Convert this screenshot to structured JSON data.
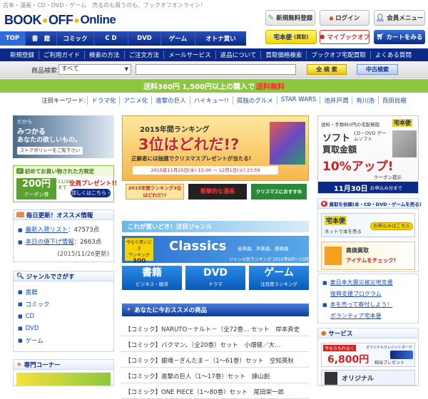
{
  "header": {
    "tagline": "古本・漫画・CD・DVD・ゲーム　売るのも買うのも、ブックオフオンライン！",
    "logo_book": "BOOK",
    "logo_off": "OFF",
    "logo_online": "Online",
    "register": "新規無料登録",
    "login": "ログイン",
    "member": "会員メニュー",
    "takuhaibin_label": "宅本便",
    "takuhaibin_sub": "(買取)",
    "mypage": "マイブックオフ",
    "cart": "カートをみる"
  },
  "nav_tabs": [
    "TOP",
    "書　籍",
    "コミック",
    "C D",
    "DVD",
    "ゲーム",
    "オトナ買い"
  ],
  "menu": [
    "新規登録",
    "ご利用ガイド",
    "検索の方法",
    "ご注文方法",
    "メールサービス",
    "返品について",
    "買取価格検索",
    "ブックオフ宅配買取",
    "よくある質問"
  ],
  "search": {
    "label": "商品検索",
    "category": "すべて",
    "query": "",
    "search_button": "全 検 索",
    "used_button": "中古検索"
  },
  "shipping": {
    "text": "送料360円 1,500円以上の購入で",
    "highlight": "送料無料"
  },
  "keywords": {
    "label": "注目キーワード:",
    "items": [
      "ドラマ化",
      "アニメ化",
      "進撃の巨人",
      "ハイキュー!!",
      "孤独のグルメ",
      "STAR WARS",
      "池井戸潤",
      "有川浩",
      "百田尚樹"
    ]
  },
  "left": {
    "banner1_line1": "だから",
    "banner1_line2": "みつかる",
    "banner1_line3": "あなたの欲しいもの。",
    "banner1_btn": "ストアポリシーをご覧下さい",
    "coupon_head": "初めてお買い物された方限定",
    "coupon_amount": "200円",
    "coupon_unit": "クーポン券",
    "coupon_date": "11/30まで",
    "coupon_present": "全員プレゼント!!",
    "coupon_btn": "詳しくはこちら",
    "daily_title": "毎日更新！オススメ情報",
    "daily_new_label": "最新入荷リスト",
    "daily_new_count": "：47573点",
    "daily_sale_label": "本日の値下げ情報",
    "daily_sale_count": "：2663点",
    "daily_updated": "(2015/11/26更新)",
    "genre_title": "ジャンルでさがす",
    "genres": [
      "書籍",
      "コミック",
      "CD",
      "DVD",
      "ゲーム"
    ],
    "special_title": "専門コーナー"
  },
  "center": {
    "ranking_year": "2015年間ランキング",
    "ranking_question": "3位はどれだ!?",
    "ranking_sub": "正解者には抽選でクリスマスプレゼントが当たる!",
    "ranking_period": "2015年11月25日(水) 15:00 ～ 12月1日(火) 23:59",
    "thumb1": "2015年間ランキング3位はどれだ!?",
    "thumb2": "衝撃的な漫画",
    "thumb3": "クリスマスにおすすめ",
    "genre_bar": "これが買いどき！注目ジャンル",
    "classics_title": "Classics",
    "classics_tag": "音楽曲、声楽曲、器楽曲",
    "classics_badge1": "今なら買いどき",
    "classics_badge2": "ランキング",
    "classics_badge3": "300",
    "classics_sub": "ジャンル別ランキング 2015年8月～10月",
    "cat_books": "書籍",
    "cat_books_sub": "ビジネス・経済",
    "cat_dvd": "DVD",
    "cat_dvd_sub": "ドラマ",
    "cat_game": "ゲーム",
    "cat_game_sub": "注目度ランキング",
    "recommend_title": "あなたに今おススメの商品",
    "items": [
      "【コミック】NARUTO－ナルト－（全72巻… セット　岸本斉史",
      "【コミック】バクマン。（全20巻）セット　小畑健／大…",
      "【コミック】銀魂－ぎんたま－（1～61巻）セット　空知英秋",
      "【コミック】進撃の巨人（1～17巻）セット　諫山創",
      "【コミック】ONE PIECE（1～80巻）セット　尾田栄一郎"
    ]
  },
  "right": {
    "tkb_line1": "送料・手数料0円の宅配買取",
    "tkb_logo": "宅本便",
    "tkb_soft": "ソフト",
    "tkb_media": "CD・DVD ゲームソフト",
    "tkb_kaitori": "買取金額",
    "tkb_percent": "10%アップ!",
    "tkb_coupon": "クーポン提示",
    "tkb_date": "11月30日",
    "tkb_apply": "お申込み分まで",
    "kaitori_title": "買取を依頼(本・CD・DVD・ゲームを売る)",
    "kaitori_logo": "宅本便",
    "kaitori_net": "ネットで本を売る",
    "kaitori_apply": "お申込みはこちら",
    "kaitori_high": "高価買取",
    "kaitori_check": "アイテムをチェック!",
    "support_line1": "東日本大震災被災地支援",
    "support_line2": "復興支援プログラム",
    "support_line3": "本を売って寄付しよう！",
    "support_line4": "ボランティア宅本便",
    "service_title": "サービス",
    "card_top": "今ならもれなく",
    "card_amount": "6,800円",
    "card_label": "オリジナルクレジットカード",
    "card_present": "相当プレゼント",
    "orig_label": "オリジナル"
  }
}
